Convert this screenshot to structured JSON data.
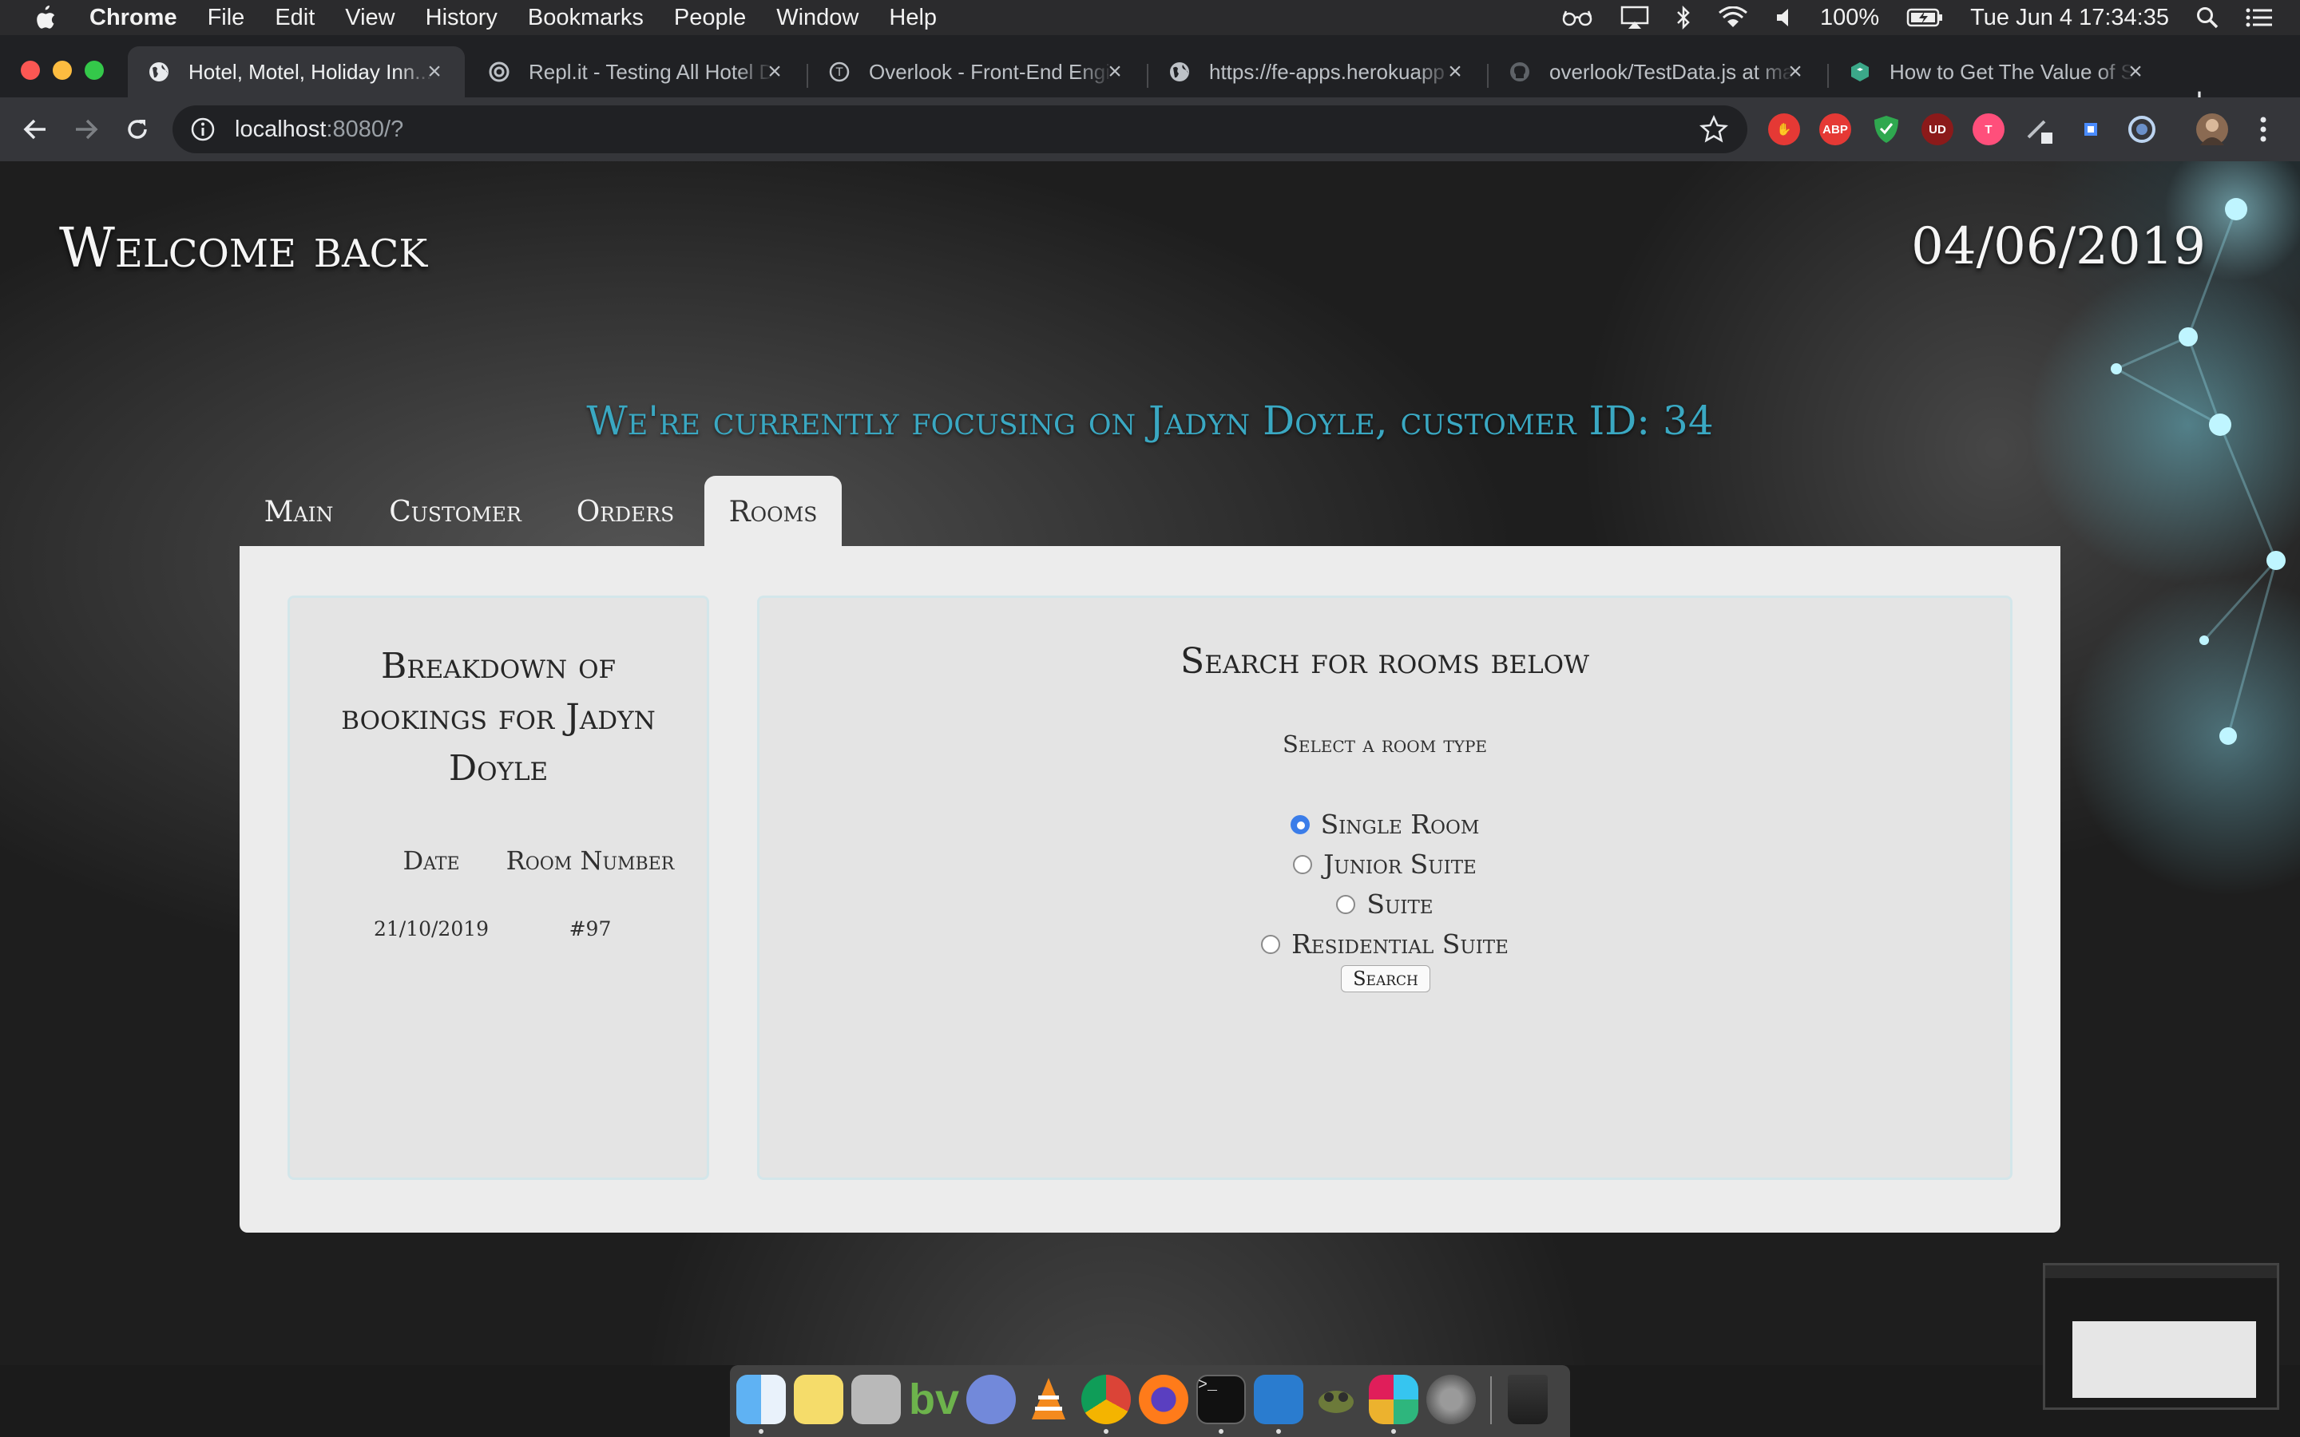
{
  "menubar": {
    "app_name": "Chrome",
    "menus": [
      "File",
      "Edit",
      "View",
      "History",
      "Bookmarks",
      "People",
      "Window",
      "Help"
    ],
    "battery": "100%",
    "clock": "Tue Jun 4  17:34:35"
  },
  "tabs": [
    {
      "title": "Hotel, Motel, Holiday Inn...",
      "icon": "globe-icon"
    },
    {
      "title": "Repl.it - Testing All Hotel D",
      "icon": "replit-icon"
    },
    {
      "title": "Overlook - Front-End Engi",
      "icon": "turing-icon"
    },
    {
      "title": "https://fe-apps.herokuapp",
      "icon": "globe-icon"
    },
    {
      "title": "overlook/TestData.js at ma",
      "icon": "github-icon"
    },
    {
      "title": "How to Get The Value of S",
      "icon": "codeburst-icon"
    }
  ],
  "toolbar": {
    "url_host": "localhost",
    "url_rest": ":8080/?"
  },
  "extensions": [
    "ublock-icon",
    "abp-icon",
    "shield-icon",
    "ud-icon",
    "t-icon",
    "pen-icon",
    "square-icon",
    "ring-icon",
    "profile-avatar"
  ],
  "page": {
    "welcome": "Welcome back",
    "date": "04/06/2019",
    "focus_text": "We're currently focusing on Jadyn Doyle, customer ID: 34",
    "nav_tabs": [
      "Main",
      "Customer",
      "Orders",
      "Rooms"
    ],
    "active_tab": "Rooms",
    "bookings": {
      "title_line1": "Breakdown of",
      "title_line2": "bookings for Jadyn",
      "title_line3": "Doyle",
      "headers": [
        "Date",
        "Room Number"
      ],
      "rows": [
        [
          "21/10/2019",
          "#97"
        ]
      ]
    },
    "search": {
      "title": "Search for rooms below",
      "label": "Select a room type",
      "options": [
        "Single Room",
        "Junior Suite",
        "Suite",
        "Residential Suite"
      ],
      "selected": "Single Room",
      "button": "Search"
    }
  },
  "colors": {
    "accent_teal": "#3aa8c2",
    "radio_blue": "#3b7de9"
  }
}
